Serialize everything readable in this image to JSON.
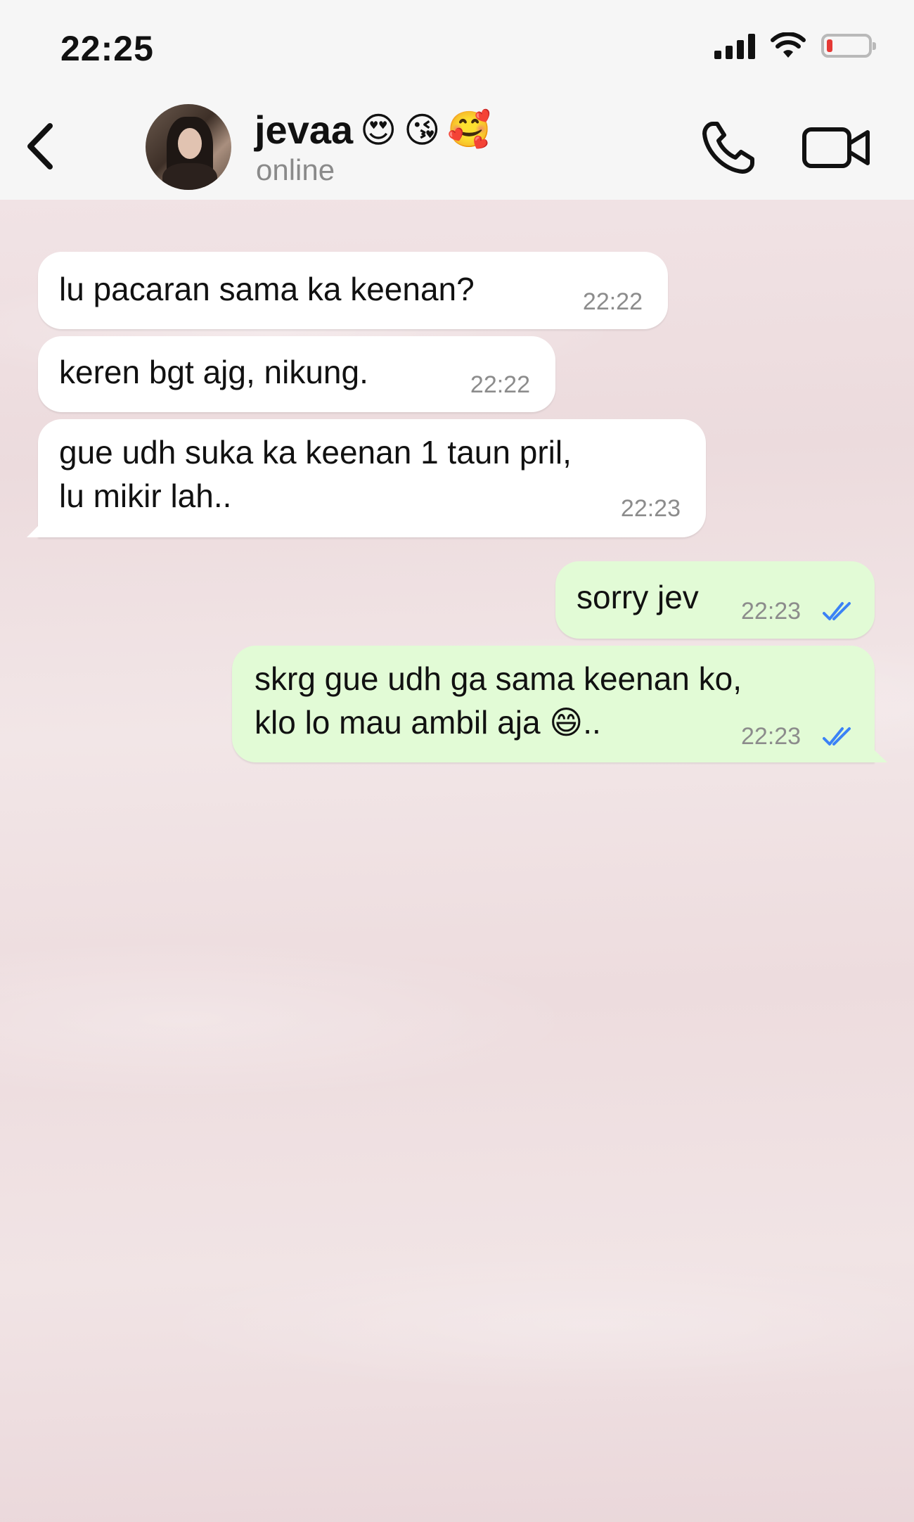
{
  "status_bar": {
    "time": "22:25",
    "battery_level": 0.15
  },
  "header": {
    "contact_name": "jevaa",
    "name_emojis": [
      "😍",
      "😘",
      "🥰"
    ],
    "status": "online",
    "icons": [
      "back-chevron-icon",
      "phone-icon",
      "video-camera-icon"
    ]
  },
  "messages": [
    {
      "direction": "in",
      "text": "lu pacaran sama ka keenan?",
      "time": "22:22"
    },
    {
      "direction": "in",
      "text": "keren bgt ajg, nikung.",
      "time": "22:22"
    },
    {
      "direction": "in",
      "text": "gue udh suka ka keenan 1 taun pril,\nlu mikir lah..",
      "time": "22:23"
    },
    {
      "direction": "out",
      "text": "sorry jev",
      "time": "22:23",
      "read": true
    },
    {
      "direction": "out",
      "text": "skrg gue udh ga sama keenan ko,\nklo lo mau ambil aja 😄..",
      "time": "22:23",
      "read": true
    }
  ],
  "colors": {
    "incoming_bubble": "#ffffff",
    "outgoing_bubble": "#e2fbd6",
    "read_ticks": "#3b82f6",
    "battery_low": "#e53935"
  }
}
